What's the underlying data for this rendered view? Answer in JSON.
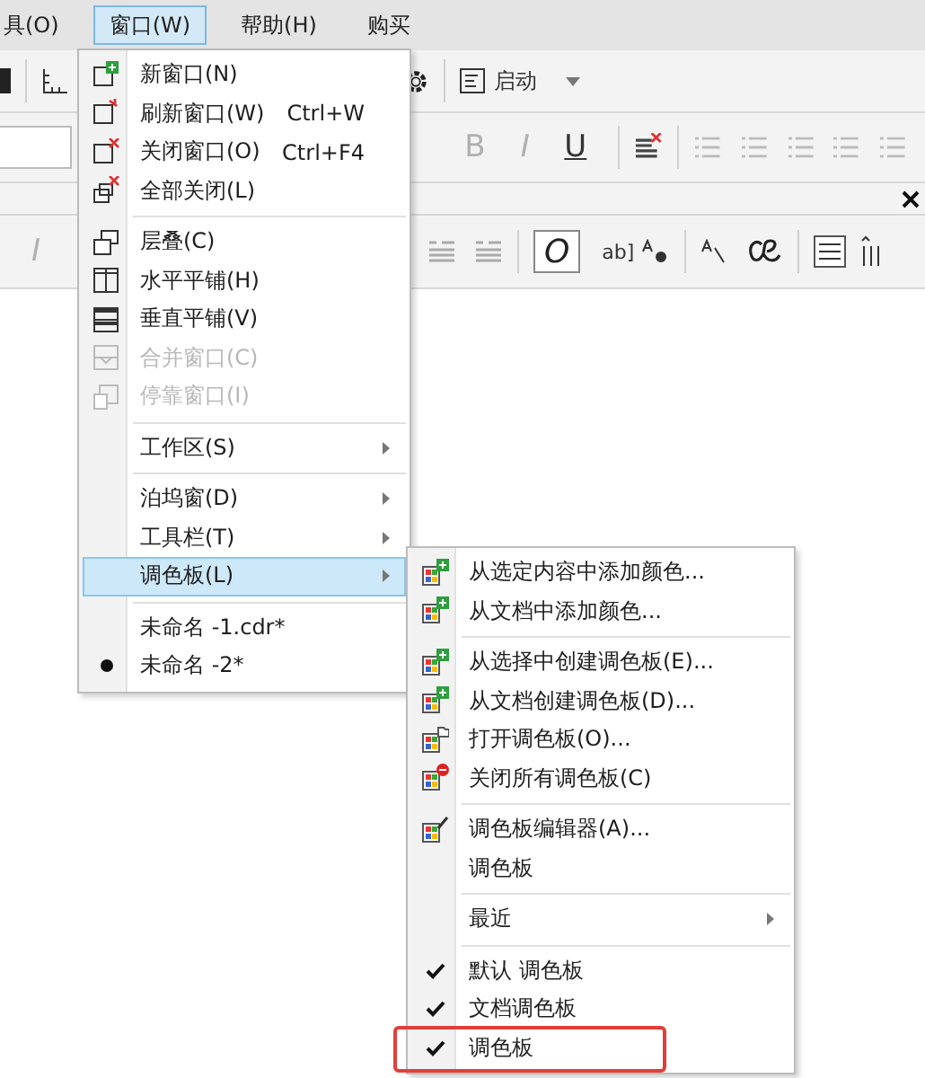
{
  "menubar": [
    {
      "label": "具(O)",
      "selected": false
    },
    {
      "label": "窗口(W)",
      "selected": true
    },
    {
      "label": "帮助(H)",
      "selected": false
    },
    {
      "label": "购买",
      "selected": false
    }
  ],
  "standard_toolbar": {
    "launch_label": "启动"
  },
  "format_toolbar": {
    "buttons": [
      {
        "label": "B",
        "disabled": true
      },
      {
        "label": "I",
        "disabled": true
      },
      {
        "label": "U",
        "disabled": false
      }
    ]
  },
  "text_toolbar": {
    "left_buttons": [
      {
        "label": "I",
        "disabled": true
      }
    ],
    "right_buttons": [
      {
        "label": "O"
      },
      {
        "label": "ab]"
      }
    ]
  },
  "window_menu": {
    "sections": [
      [
        {
          "label": "新窗口(N)",
          "selected": false,
          "disabled": false,
          "checked": false
        },
        {
          "label": "刷新窗口(W)",
          "shortcut": "Ctrl+W",
          "selected": false,
          "disabled": false,
          "checked": false
        },
        {
          "label": "关闭窗口(O)",
          "shortcut": "Ctrl+F4",
          "selected": false,
          "disabled": false,
          "checked": false
        },
        {
          "label": "全部关闭(L)",
          "selected": false,
          "disabled": false,
          "checked": false
        }
      ],
      [
        {
          "label": "层叠(C)",
          "selected": false,
          "disabled": false,
          "checked": false
        },
        {
          "label": "水平平铺(H)",
          "selected": false,
          "disabled": false,
          "checked": false
        },
        {
          "label": "垂直平铺(V)",
          "selected": false,
          "disabled": false,
          "checked": false
        },
        {
          "label": "合并窗口(C)",
          "selected": false,
          "disabled": true,
          "checked": false
        },
        {
          "label": "停靠窗口(I)",
          "selected": false,
          "disabled": true,
          "checked": false
        }
      ],
      [
        {
          "label": "工作区(S)",
          "submenu": true,
          "selected": false,
          "disabled": false,
          "checked": false
        }
      ],
      [
        {
          "label": "泊坞窗(D)",
          "submenu": true,
          "selected": false,
          "disabled": false,
          "checked": false
        },
        {
          "label": "工具栏(T)",
          "submenu": true,
          "selected": false,
          "disabled": false,
          "checked": false
        },
        {
          "label": "调色板(L)",
          "submenu": true,
          "selected": true,
          "disabled": false,
          "checked": false
        }
      ],
      [
        {
          "label": "未命名 -1.cdr*",
          "selected": false,
          "disabled": false,
          "checked": false
        },
        {
          "label": "未命名 -2*",
          "selected": false,
          "disabled": false,
          "checked": true
        }
      ]
    ]
  },
  "palette_menu": {
    "sections": [
      [
        {
          "label": "从选定内容中添加颜色...",
          "checked": false,
          "outlined": false
        },
        {
          "label": "从文档中添加颜色...",
          "checked": false,
          "outlined": false
        }
      ],
      [
        {
          "label": "从选择中创建调色板(E)...",
          "checked": false,
          "outlined": false
        },
        {
          "label": "从文档创建调色板(D)...",
          "checked": false,
          "outlined": false
        },
        {
          "label": "打开调色板(O)...",
          "checked": false,
          "outlined": false
        },
        {
          "label": "关闭所有调色板(C)",
          "checked": false,
          "outlined": false
        }
      ],
      [
        {
          "label": "调色板编辑器(A)...",
          "checked": false,
          "outlined": false
        },
        {
          "label": "调色板",
          "checked": false,
          "outlined": false
        }
      ],
      [
        {
          "label": "最近",
          "submenu": true,
          "checked": false,
          "outlined": false
        }
      ],
      [
        {
          "label": "默认 调色板",
          "checked": true,
          "outlined": false
        },
        {
          "label": "文档调色板",
          "checked": true,
          "outlined": false
        },
        {
          "label": "调色板",
          "checked": true,
          "outlined": true
        }
      ]
    ]
  }
}
